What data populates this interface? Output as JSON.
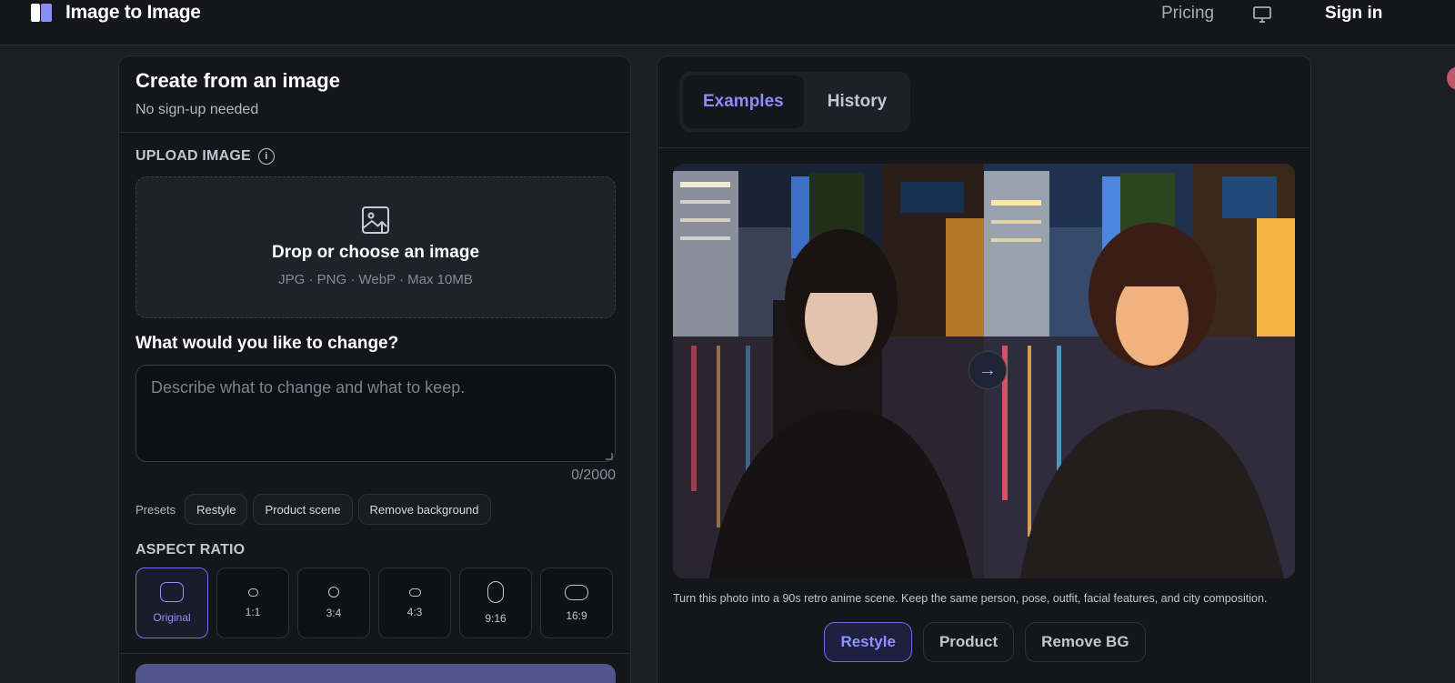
{
  "header": {
    "brand": "Image to Image",
    "nav": {
      "pricing": "Pricing",
      "sign_in": "Sign in"
    },
    "icons": {
      "logo": "image-to-image-logo",
      "display": "monitor-icon"
    }
  },
  "create_panel": {
    "title": "Create from an image",
    "subtitle": "No sign-up needed",
    "upload": {
      "label": "UPLOAD IMAGE",
      "dropzone_title": "Drop or choose an image",
      "dropzone_hint": "JPG · PNG · WebP · Max 10MB"
    },
    "prompt": {
      "label": "What would you like to change?",
      "placeholder": "Describe what to change and what to keep.",
      "value": "",
      "counter": "0/2000"
    },
    "presets": {
      "label": "Presets",
      "items": [
        "Restyle",
        "Product scene",
        "Remove background"
      ]
    },
    "aspect_ratio": {
      "label": "ASPECT RATIO",
      "selected": "Original",
      "options": [
        "Original",
        "1:1",
        "3:4",
        "4:3",
        "9:16",
        "16:9"
      ]
    }
  },
  "examples_panel": {
    "tabs": {
      "active": "Examples",
      "inactive": "History"
    },
    "caption": "Turn this photo into a 90s retro anime scene. Keep the same person, pose, outfit, facial features, and city composition.",
    "categories": [
      "Restyle",
      "Product",
      "Remove BG"
    ],
    "active_category": "Restyle",
    "compare_arrow": "→"
  },
  "colors": {
    "accent": "#8b8cf6",
    "background": "#1c1e24",
    "panel": "#15161b"
  }
}
